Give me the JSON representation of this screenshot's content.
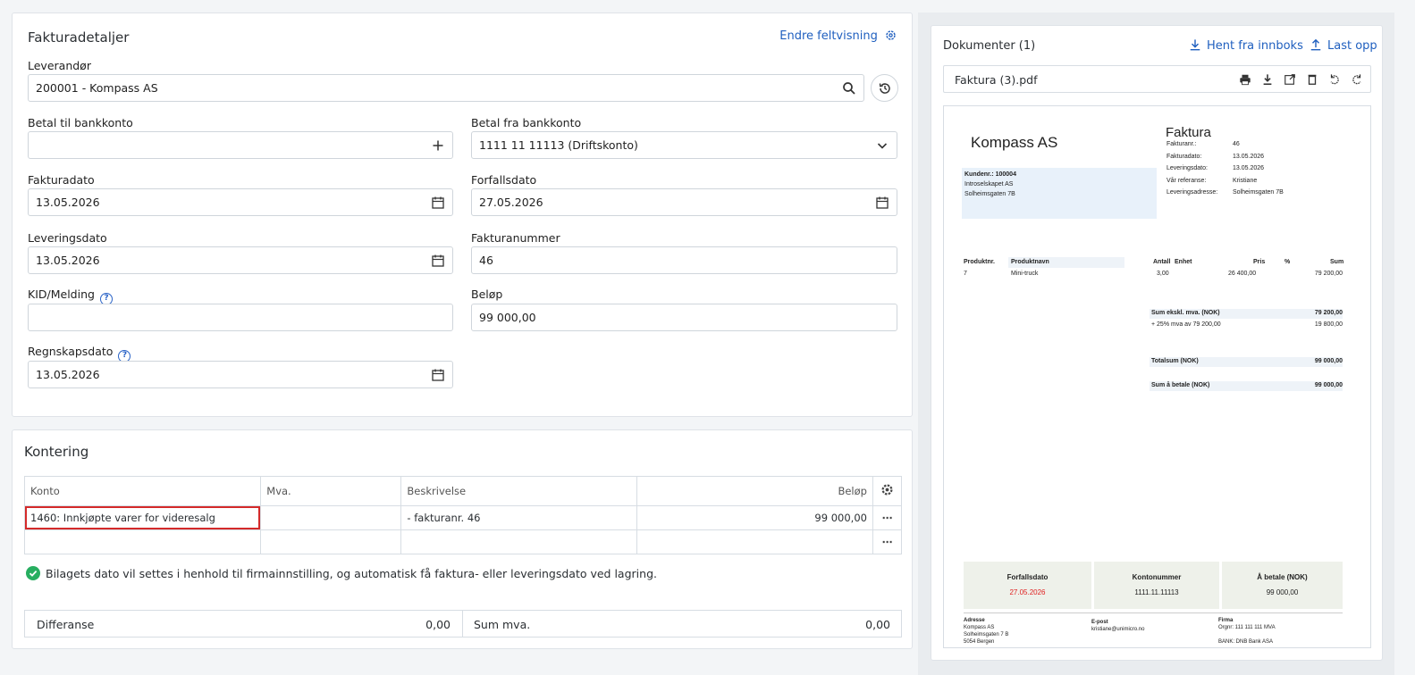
{
  "details": {
    "title": "Fakturadetaljer",
    "change_view_label": "Endre feltvisning",
    "supplier_label": "Leverandør",
    "supplier_value": "200001 - Kompass AS",
    "pay_to_label": "Betal til bankkonto",
    "pay_to_value": "",
    "pay_from_label": "Betal fra bankkonto",
    "pay_from_value": "1111 11 11113 (Driftskonto)",
    "invoice_date_label": "Fakturadato",
    "invoice_date_value": "13.05.2026",
    "due_date_label": "Forfallsdato",
    "due_date_value": "27.05.2026",
    "delivery_date_label": "Leveringsdato",
    "delivery_date_value": "13.05.2026",
    "invoice_number_label": "Fakturanummer",
    "invoice_number_value": "46",
    "kid_label": "KID/Melding",
    "kid_value": "",
    "amount_label": "Beløp",
    "amount_value": "99 000,00",
    "accounting_date_label": "Regnskapsdato",
    "accounting_date_value": "13.05.2026"
  },
  "posting": {
    "title": "Kontering",
    "columns": [
      "Konto",
      "Mva.",
      "Beskrivelse",
      "Beløp"
    ],
    "rows": [
      {
        "konto": "1460: Innkjøpte varer for videresalg",
        "mva": "",
        "beskrivelse": "- fakturanr. 46",
        "belop": "99 000,00"
      },
      {
        "konto": "",
        "mva": "",
        "beskrivelse": "",
        "belop": ""
      }
    ],
    "info_text": "Bilagets dato vil settes i henhold til firmainnstilling, og automatisk få faktura- eller leveringsdato ved lagring.",
    "diff_label": "Differanse",
    "diff_value": "0,00",
    "vat_label": "Sum mva.",
    "vat_value": "0,00"
  },
  "documents": {
    "title": "Dokumenter (1)",
    "fetch_label": "Hent fra innboks",
    "upload_label": "Last opp",
    "file_name": "Faktura (3).pdf"
  },
  "invoice_doc": {
    "company": "Kompass AS",
    "heading": "Faktura",
    "meta": [
      {
        "k": "Fakturanr.:",
        "v": "46"
      },
      {
        "k": "Fakturadato:",
        "v": "13.05.2026"
      },
      {
        "k": "Leveringsdato:",
        "v": "13.05.2026"
      },
      {
        "k": "Vår referanse:",
        "v": "Kristiane"
      },
      {
        "k": "Leveringsadresse:",
        "v": "Solheimsgaten 7B"
      }
    ],
    "customer_no": "Kundenr.: 100004",
    "customer_name": "Introselskapet AS",
    "customer_addr": "Solheimsgaten 7B",
    "line_headers": [
      "Produktnr.",
      "Produktnavn",
      "Antall",
      "Enhet",
      "Pris",
      "%",
      "Sum"
    ],
    "line": {
      "nr": "7",
      "name": "Mini-truck",
      "qty": "3,00",
      "unit": "",
      "price": "26 400,00",
      "pct": "",
      "sum": "79 200,00"
    },
    "sum_ex_label": "Sum ekskl. mva. (NOK)",
    "sum_ex_value": "79 200,00",
    "vat_label": "+ 25% mva av 79 200,00",
    "vat_value": "19 800,00",
    "total_label": "Totalsum (NOK)",
    "total_value": "99 000,00",
    "to_pay_label": "Sum å betale (NOK)",
    "to_pay_value": "99 000,00",
    "box_due_label": "Forfallsdato",
    "box_due_value": "27.05.2026",
    "box_account_label": "Kontonummer",
    "box_account_value": "1111.11.11113",
    "box_pay_label": "Å betale (NOK)",
    "box_pay_value": "99 000,00",
    "footer_addr_label": "Adresse",
    "footer_addr_lines": [
      "Kompass AS",
      "Solheimsgaten 7 B",
      "5054 Bergen"
    ],
    "footer_email_label": "E-post",
    "footer_email": "kristiane@unimicro.no",
    "footer_firm_label": "Firma",
    "footer_firm_lines": [
      "Orgnr: 111 111 111 MVA",
      "BANK: DNB Bank ASA"
    ]
  },
  "colors": {
    "accent": "#1f5fbf",
    "success": "#27ae60",
    "danger": "#e02020",
    "highlight_border": "#d42a2a"
  }
}
